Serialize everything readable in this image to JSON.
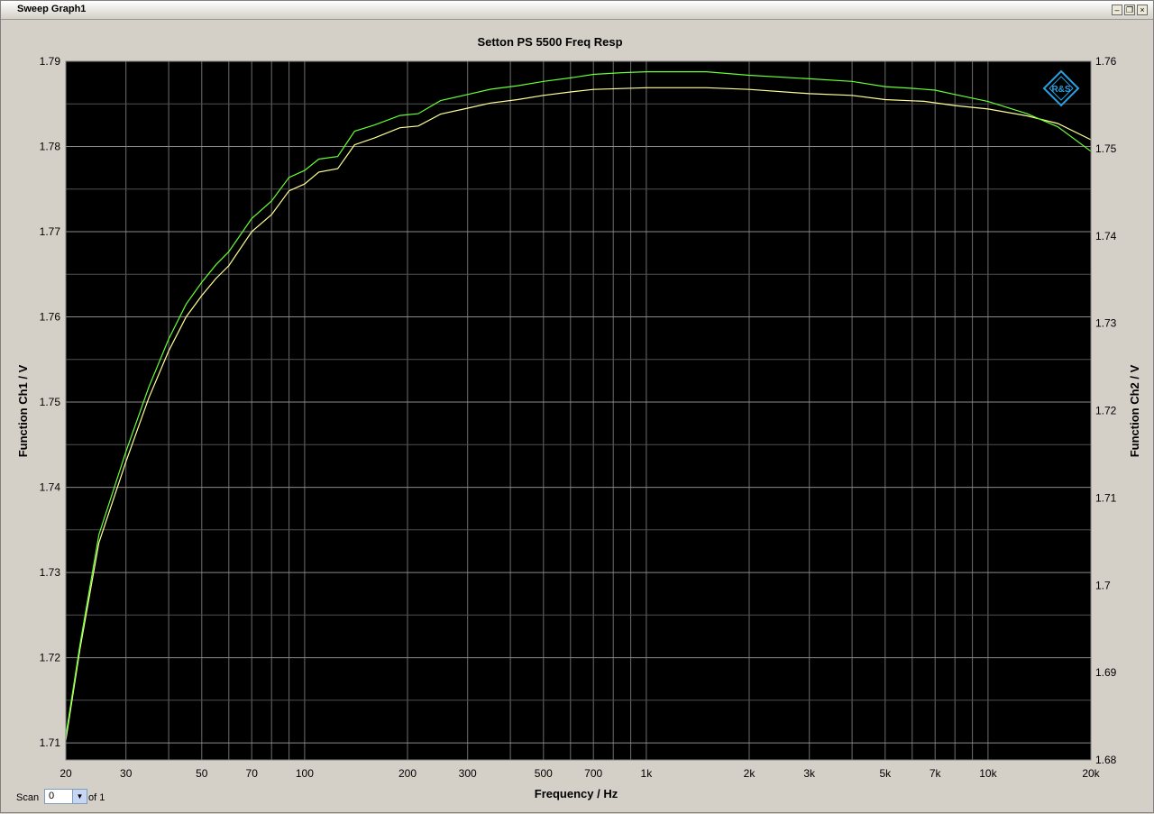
{
  "window": {
    "title": "Sweep Graph1",
    "buttons": [
      "minimize",
      "restore",
      "close"
    ]
  },
  "scan": {
    "label": "Scan",
    "value": "0",
    "of_label": "of 1"
  },
  "logo": {
    "text": "R&S"
  },
  "chart_data": {
    "type": "line",
    "title": "Setton PS 5500 Freq Resp",
    "xlabel": "Frequency / Hz",
    "ylabel_left": "Function Ch1 / V",
    "ylabel_right": "Function Ch2 / V",
    "x_scale": "log",
    "xlim": [
      20,
      20000
    ],
    "ylim_left": [
      1.708,
      1.79
    ],
    "ylim_right": [
      1.68,
      1.76
    ],
    "x_ticks": [
      20,
      30,
      50,
      70,
      100,
      200,
      300,
      500,
      700,
      1000,
      2000,
      3000,
      5000,
      7000,
      10000,
      20000
    ],
    "x_tick_labels": [
      "20",
      "30",
      "50",
      "70",
      "100",
      "200",
      "300",
      "500",
      "700",
      "1k",
      "2k",
      "3k",
      "5k",
      "7k",
      "10k",
      "20k"
    ],
    "y_left_ticks": [
      1.71,
      1.72,
      1.73,
      1.74,
      1.75,
      1.76,
      1.77,
      1.78,
      1.79
    ],
    "y_left_tick_labels": [
      "1.71",
      "1.72",
      "1.73",
      "1.74",
      "1.75",
      "1.76",
      "1.77",
      "1.78",
      "1.79"
    ],
    "y_right_ticks": [
      1.68,
      1.69,
      1.7,
      1.71,
      1.72,
      1.73,
      1.74,
      1.75,
      1.76
    ],
    "y_right_tick_labels": [
      "1.68",
      "1.69",
      "1.7",
      "1.71",
      "1.72",
      "1.73",
      "1.74",
      "1.75",
      "1.76"
    ],
    "grid": true,
    "background": "#000000",
    "series": [
      {
        "axis": "left",
        "color": "#ffff99",
        "x": [
          20,
          22,
          25,
          30,
          35,
          40,
          45,
          50,
          55,
          60,
          70,
          80,
          90,
          100,
          110,
          125,
          140,
          160,
          190,
          215,
          250,
          300,
          350,
          420,
          500,
          600,
          700,
          850,
          1000,
          1200,
          1500,
          2000,
          3000,
          4000,
          5000,
          6500,
          8000,
          10000,
          13000,
          16000,
          20000
        ],
        "y": [
          1.7103,
          1.721,
          1.7335,
          1.743,
          1.7505,
          1.756,
          1.76,
          1.7625,
          1.7645,
          1.766,
          1.77,
          1.772,
          1.7748,
          1.7756,
          1.777,
          1.7774,
          1.7802,
          1.781,
          1.7822,
          1.7824,
          1.7838,
          1.7845,
          1.7851,
          1.7855,
          1.786,
          1.7864,
          1.7867,
          1.7868,
          1.7869,
          1.7869,
          1.7869,
          1.7867,
          1.7862,
          1.786,
          1.7855,
          1.7853,
          1.7848,
          1.7844,
          1.7836,
          1.7827,
          1.7808
        ]
      },
      {
        "axis": "right",
        "color": "#66ff33",
        "x": [
          20,
          22,
          25,
          30,
          35,
          40,
          45,
          50,
          55,
          60,
          70,
          80,
          90,
          100,
          110,
          125,
          140,
          160,
          190,
          215,
          250,
          300,
          350,
          420,
          500,
          600,
          700,
          850,
          1000,
          1200,
          1500,
          2000,
          3000,
          4000,
          5000,
          6000,
          7000,
          8000,
          10000,
          13000,
          16000,
          20000
        ],
        "y": [
          1.6827,
          1.6932,
          1.7058,
          1.7153,
          1.7227,
          1.7282,
          1.7322,
          1.7347,
          1.7367,
          1.7382,
          1.742,
          1.744,
          1.7467,
          1.7475,
          1.7488,
          1.7491,
          1.752,
          1.7527,
          1.7538,
          1.754,
          1.7555,
          1.7562,
          1.7568,
          1.7572,
          1.7577,
          1.7581,
          1.7585,
          1.7587,
          1.7588,
          1.7588,
          1.7588,
          1.7584,
          1.758,
          1.7577,
          1.7571,
          1.7569,
          1.7567,
          1.7562,
          1.7554,
          1.754,
          1.7525,
          1.7497
        ]
      }
    ]
  }
}
